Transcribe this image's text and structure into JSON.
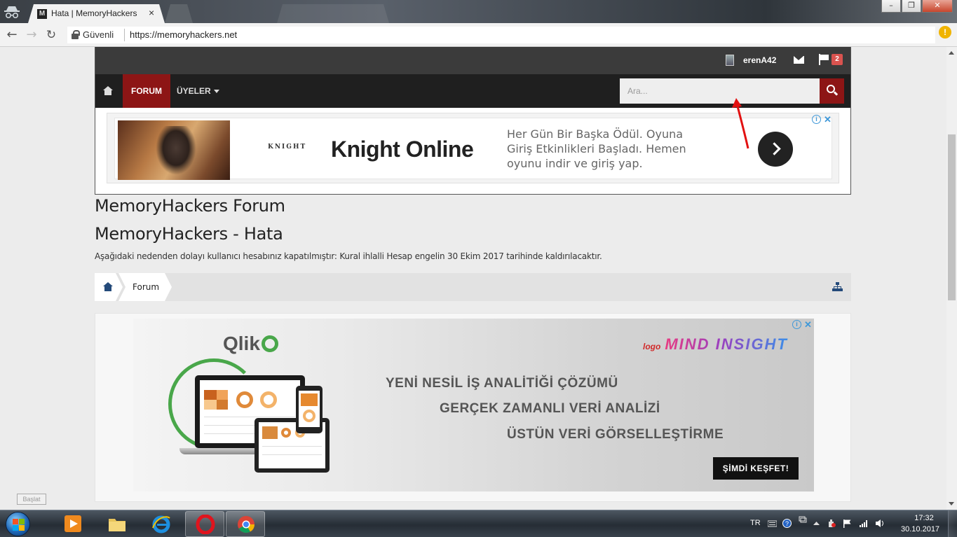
{
  "browser": {
    "tab_title": "Hata | MemoryHackers",
    "tab_favicon": "M",
    "tab_close": "×",
    "secure_label": "Güvenli",
    "url": "https://memoryhackers.net",
    "window_buttons": [
      "–",
      "❐",
      "✕"
    ],
    "extension_badge": "!"
  },
  "site": {
    "userbar": {
      "username": "erenA42",
      "alert_count": "2"
    },
    "nav": {
      "forum": "FORUM",
      "members": "ÜYELER",
      "search_placeholder": "Ara..."
    },
    "ad_top": {
      "logo": "KNIGHT",
      "title": "Knight Online",
      "text": "Her Gün Bir Başka Ödül. Oyuna Giriş Etkinlikleri Başladı. Hemen oyunu indir ve giriş yap.",
      "info": "i",
      "close": "✕"
    },
    "forum_title": "MemoryHackers Forum",
    "page_title": "MemoryHackers - Hata",
    "message": "Aşağıdaki nedenden dolayı kullanıcı hesabınız kapatılmıştır: Kural ihlalli Hesap engelin 30 Ekim 2017 tarihinde kaldırılacaktır.",
    "breadcrumb": {
      "forum": "Forum"
    },
    "ad_bottom": {
      "qlik": "Qlik",
      "brand_prefix": "logo",
      "brand": "MIND INSIGHT",
      "line1": "YENİ NESİL İŞ ANALİTİĞİ ÇÖZÜMÜ",
      "line2": "GERÇEK ZAMANLI VERİ ANALİZİ",
      "line3": "ÜSTÜN VERİ GÖRSELLEŞTİRME",
      "cta": "ŞİMDİ KEŞFET!",
      "info": "i",
      "close": "✕"
    }
  },
  "tooltip": "Başlat",
  "taskbar": {
    "lang": "TR",
    "time": "17:32",
    "date": "30.10.2017"
  },
  "colors": {
    "accent_red": "#8d1515",
    "dark_bar": "#3b3b3b",
    "nav_bg": "#1f1f1f",
    "link_blue": "#244a7a",
    "qlik_green": "#49a74a"
  }
}
